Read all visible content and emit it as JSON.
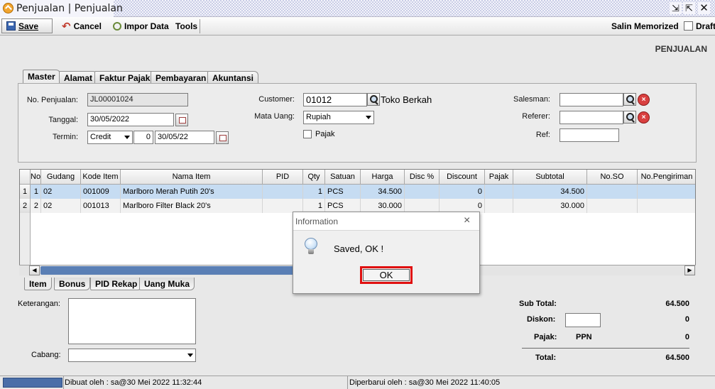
{
  "window": {
    "title": "Penjualan | Penjualan"
  },
  "toolbar": {
    "save_label": "Save",
    "cancel_label": "Cancel",
    "impor_label": "Impor Data",
    "tools_label": "Tools",
    "salin_label": "Salin Memorized",
    "draft_label": "Draft"
  },
  "page_heading": "PENJUALAN",
  "tabs": [
    "Master",
    "Alamat",
    "Faktur Pajak",
    "Pembayaran",
    "Akuntansi"
  ],
  "master": {
    "no_penjualan_label": "No. Penjualan:",
    "no_penjualan_value": "JL00001024",
    "tanggal_label": "Tanggal:",
    "tanggal_value": "30/05/2022",
    "termin_label": "Termin:",
    "termin_value": "Credit",
    "termin_days": "0",
    "termin_date": "30/05/22",
    "customer_label": "Customer:",
    "customer_code": "01012",
    "customer_name": "Toko Berkah",
    "mata_uang_label": "Mata Uang:",
    "mata_uang_value": "Rupiah",
    "pajak_label": "Pajak",
    "salesman_label": "Salesman:",
    "salesman_value": "",
    "referer_label": "Referer:",
    "referer_value": "",
    "ref_label": "Ref:",
    "ref_value": ""
  },
  "grid": {
    "columns": [
      "No",
      "Gudang",
      "Kode Item",
      "Nama Item",
      "PID",
      "Qty",
      "Satuan",
      "Harga",
      "Disc %",
      "Discount",
      "Pajak",
      "Subtotal",
      "No.SO",
      "No.Pengiriman"
    ],
    "rows": [
      {
        "rownum": "1",
        "no": "1",
        "gudang": "02",
        "kode": "001009",
        "nama": "Marlboro Merah Putih 20's",
        "pid": "",
        "qty": "1",
        "satuan": "PCS",
        "harga": "34.500",
        "disc": "",
        "discount": "0",
        "pajak": "",
        "subtotal": "34.500",
        "so": "",
        "pengiriman": ""
      },
      {
        "rownum": "2",
        "no": "2",
        "gudang": "02",
        "kode": "001013",
        "nama": "Marlboro Filter Black 20's",
        "pid": "",
        "qty": "1",
        "satuan": "PCS",
        "harga": "30.000",
        "disc": "",
        "discount": "0",
        "pajak": "",
        "subtotal": "30.000",
        "so": "",
        "pengiriman": ""
      }
    ]
  },
  "bottom_tabs": [
    "Item",
    "Bonus",
    "PID Rekap",
    "Uang Muka"
  ],
  "footer": {
    "keterangan_label": "Keterangan:",
    "cabang_label": "Cabang:",
    "cabang_value": "",
    "subtotal_label": "Sub Total:",
    "subtotal_value": "64.500",
    "diskon_label": "Diskon:",
    "diskon_input": "",
    "diskon_value": "0",
    "pajak_label": "Pajak:",
    "pajak_type": "PPN",
    "pajak_value": "0",
    "total_label": "Total:",
    "total_value": "64.500"
  },
  "status": {
    "dibuat": "Dibuat oleh : sa@30 Mei 2022  11:32:44",
    "diperbarui": "Diperbarui oleh : sa@30 Mei 2022  11:40:05"
  },
  "dialog": {
    "title": "Information",
    "message": "Saved, OK !",
    "ok_label": "OK",
    "icon": "lightbulb-icon"
  }
}
